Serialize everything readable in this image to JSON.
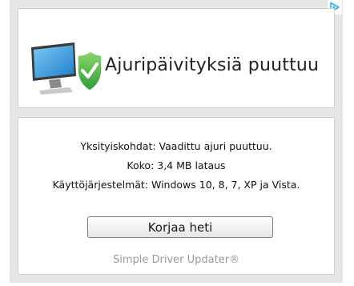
{
  "ad": {
    "headline": "Ajuripäivityksiä puuttuu",
    "details_line": "Yksityiskohdat: Vaadittu ajuri puuttuu.",
    "size_line": "Koko: 3,4 MB lataus",
    "os_line": "Käyttöjärjestelmät: Windows 10, 8, 7, XP ja Vista.",
    "cta_label": "Korjaa heti",
    "brand": "Simple Driver Updater®"
  },
  "icons": {
    "adchoices": "adchoices-triangle-icon",
    "product": "monitor-with-shield-icon"
  },
  "colors": {
    "frame": "#e6e6e6",
    "panel": "#ffffff",
    "shield_green": "#4db848",
    "screen_blue": "#2a8fd8",
    "adchoices_cyan": "#2ab3e6",
    "brand_gray": "#9a9a9a"
  }
}
